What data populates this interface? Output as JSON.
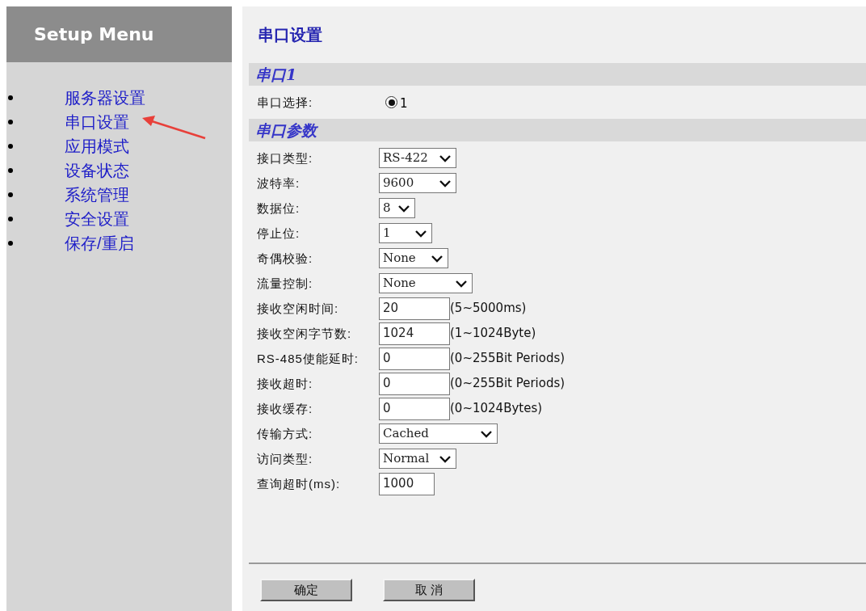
{
  "sidebar": {
    "title": "Setup Menu",
    "items": [
      {
        "label": "服务器设置"
      },
      {
        "label": "串口设置"
      },
      {
        "label": "应用模式"
      },
      {
        "label": "设备状态"
      },
      {
        "label": "系统管理"
      },
      {
        "label": "安全设置"
      },
      {
        "label": "保存/重启"
      }
    ]
  },
  "page_title": "串口设置",
  "sections": [
    {
      "title": "串口1",
      "fields": [
        {
          "kind": "radio",
          "label": "串口选择:",
          "options": [
            {
              "label": "1",
              "checked": true
            }
          ]
        }
      ]
    },
    {
      "title": "串口参数",
      "fields": [
        {
          "kind": "select",
          "label": "接口类型:",
          "value": "RS-422"
        },
        {
          "kind": "select",
          "label": "波特率:",
          "value": "9600"
        },
        {
          "kind": "select",
          "label": "数据位:",
          "value": "8"
        },
        {
          "kind": "select",
          "label": "停止位:",
          "value": "1"
        },
        {
          "kind": "select",
          "label": "奇偶校验:",
          "value": "None"
        },
        {
          "kind": "select",
          "label": "流量控制:",
          "value": "None"
        },
        {
          "kind": "text",
          "label": "接收空闲时间:",
          "value": "20",
          "hint": "(5~5000ms)"
        },
        {
          "kind": "text",
          "label": "接收空闲字节数:",
          "value": "1024",
          "hint": "(1~1024Byte)"
        },
        {
          "kind": "text",
          "label": "RS-485使能延时:",
          "value": "0",
          "hint": "(0~255Bit Periods)"
        },
        {
          "kind": "text",
          "label": "接收超时:",
          "value": "0",
          "hint": "(0~255Bit Periods)"
        },
        {
          "kind": "text",
          "label": "接收缓存:",
          "value": "0",
          "hint": "(0~1024Bytes)"
        },
        {
          "kind": "select",
          "label": "传输方式:",
          "value": "Cached"
        },
        {
          "kind": "select",
          "label": "访问类型:",
          "value": "Normal"
        },
        {
          "kind": "text",
          "label": "查询超时(ms):",
          "value": "1000"
        }
      ]
    }
  ],
  "buttons": [
    "确定",
    "取 消"
  ]
}
